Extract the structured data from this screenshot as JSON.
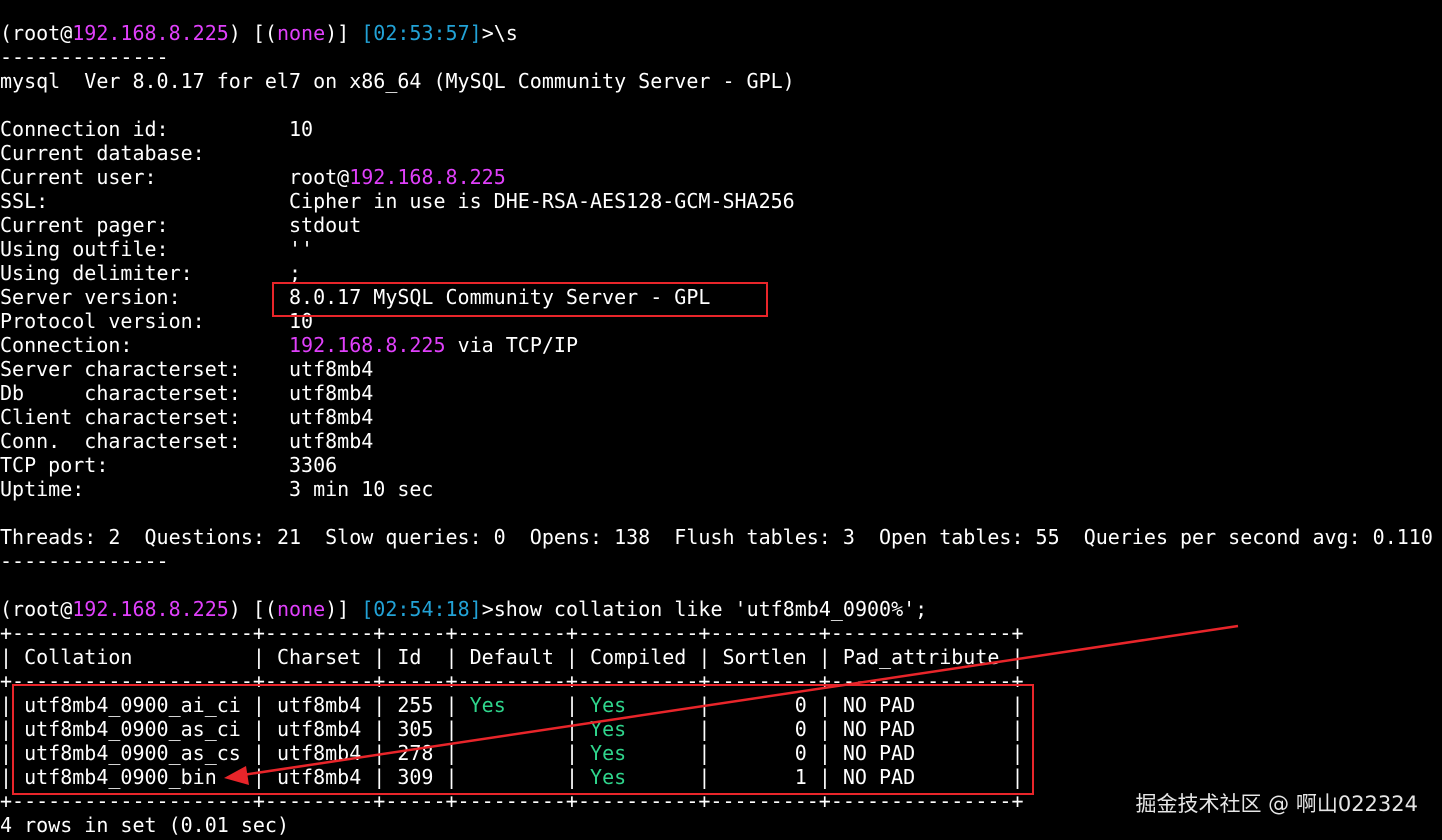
{
  "prompt1": {
    "open": "(root@",
    "host": "192.168.8.225",
    "mid": ") [(",
    "db": "none",
    "mid2": ")] ",
    "time": "[02:53:57]",
    "cmd": ">\\s"
  },
  "separator": "--------------",
  "version_line": "mysql  Ver 8.0.17 for el7 on x86_64 (MySQL Community Server - GPL)",
  "status": {
    "connection_id": {
      "label": "Connection id:          ",
      "value": "10"
    },
    "current_database": {
      "label": "Current database:",
      "value": ""
    },
    "current_user": {
      "label": "Current user:           ",
      "value_prefix": "root@",
      "value_host": "192.168.8.225"
    },
    "ssl": {
      "label": "SSL:                    ",
      "value": "Cipher in use is DHE-RSA-AES128-GCM-SHA256"
    },
    "current_pager": {
      "label": "Current pager:          ",
      "value": "stdout"
    },
    "using_outfile": {
      "label": "Using outfile:          ",
      "value": "''"
    },
    "using_delimiter": {
      "label": "Using delimiter:        ",
      "value": ";"
    },
    "server_version": {
      "label": "Server version:         ",
      "value": "8.0.17 MySQL Community Server - GPL"
    },
    "protocol_version": {
      "label": "Protocol version:       ",
      "value": "10"
    },
    "connection": {
      "label": "Connection:             ",
      "value_host": "192.168.8.225",
      "value_suffix": " via TCP/IP"
    },
    "server_charset": {
      "label": "Server characterset:    ",
      "value": "utf8mb4"
    },
    "db_charset": {
      "label": "Db     characterset:    ",
      "value": "utf8mb4"
    },
    "client_charset": {
      "label": "Client characterset:    ",
      "value": "utf8mb4"
    },
    "conn_charset": {
      "label": "Conn.  characterset:    ",
      "value": "utf8mb4"
    },
    "tcp_port": {
      "label": "TCP port:               ",
      "value": "3306"
    },
    "uptime": {
      "label": "Uptime:                 ",
      "value": "3 min 10 sec"
    }
  },
  "threads_line": "Threads: 2  Questions: 21  Slow queries: 0  Opens: 138  Flush tables: 3  Open tables: 55  Queries per second avg: 0.110",
  "prompt2": {
    "open": "(root@",
    "host": "192.168.8.225",
    "mid": ") [(",
    "db": "none",
    "mid2": ")] ",
    "time": "[02:54:18]",
    "cmd": ">show collation like 'utf8mb4_0900%';"
  },
  "table": {
    "border": "+--------------------+---------+-----+---------+----------+---------+---------------+",
    "header": "| Collation          | Charset | Id  | Default | Compiled | Sortlen | Pad_attribute |",
    "rows": [
      {
        "c1": "| utf8mb4_0900_ai_ci | utf8mb4 | 255 | ",
        "default": "Yes",
        "c2": "     | ",
        "compiled": "Yes",
        "c3": "      |       0 | NO PAD        |"
      },
      {
        "c1": "| utf8mb4_0900_as_ci | utf8mb4 | 305 | ",
        "default": "",
        "c2": "        | ",
        "compiled": "Yes",
        "c3": "      |       0 | NO PAD        |"
      },
      {
        "c1": "| utf8mb4_0900_as_cs | utf8mb4 | 278 | ",
        "default": "",
        "c2": "        | ",
        "compiled": "Yes",
        "c3": "      |       0 | NO PAD        |"
      },
      {
        "c1": "| utf8mb4_0900_bin   | utf8mb4 | 309 | ",
        "default": "",
        "c2": "        | ",
        "compiled": "Yes",
        "c3": "      |       1 | NO PAD        |"
      }
    ]
  },
  "result_line": "4 rows in set (0.01 sec)",
  "watermark": "掘金技术社区 @ 啊山022324",
  "colors": {
    "host": "#e040fb",
    "time": "#22a2d6",
    "yes": "#2fd58c",
    "annotation": "#e8252a"
  }
}
